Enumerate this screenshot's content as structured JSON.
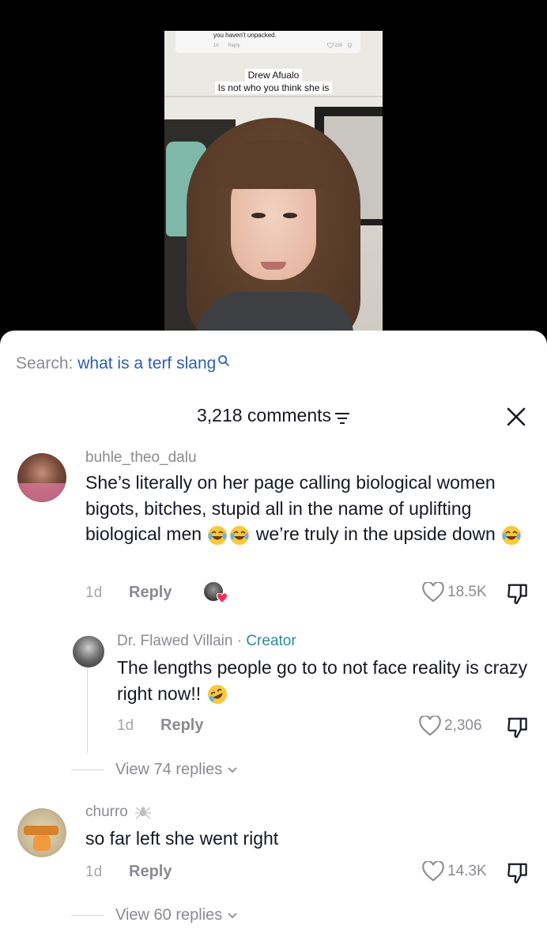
{
  "video": {
    "prev_comment_text": "you haven't unpacked.",
    "prev_comment_time": "1h",
    "prev_comment_reply": "Reply",
    "prev_comment_likes": "235",
    "caption_line1": "Drew Afualo",
    "caption_line2": "Is not who you think she is"
  },
  "search": {
    "label": "Search:",
    "term": "what is a terf slang"
  },
  "header": {
    "count": "3,218 comments"
  },
  "comments": [
    {
      "username": "buhle_theo_dalu",
      "text_parts": [
        "She’s literally on her page calling biological women bigots, bitches, stupid all in the name of uplifting biological men ",
        " we’re truly in the upside down "
      ],
      "time": "1d",
      "reply": "Reply",
      "likes": "18.5K",
      "creator_liked": true
    },
    {
      "username": "Dr. Flawed Villain",
      "creator_sep": " · ",
      "creator_label": "Creator",
      "text_part": "The lengths people go to to not face reality is crazy right now!! ",
      "time": "1d",
      "reply": "Reply",
      "likes": "2,306"
    },
    {
      "username": "churro",
      "text": "so far left she went right",
      "time": "1d",
      "reply": "Reply",
      "likes": "14.3K"
    }
  ],
  "view_replies": [
    "View 74 replies",
    "View 60 replies"
  ],
  "colors": {
    "accent_link": "#2b5fae",
    "creator": "#2a8a9b",
    "muted": "#8a8b91",
    "heart_badge": "#fe2c55"
  },
  "icons": [
    "search-icon",
    "filter-icon",
    "close-icon",
    "heart-outline-icon",
    "dislike-icon",
    "chevron-down-icon",
    "spider-icon",
    "laughing-emoji",
    "rofl-emoji"
  ]
}
